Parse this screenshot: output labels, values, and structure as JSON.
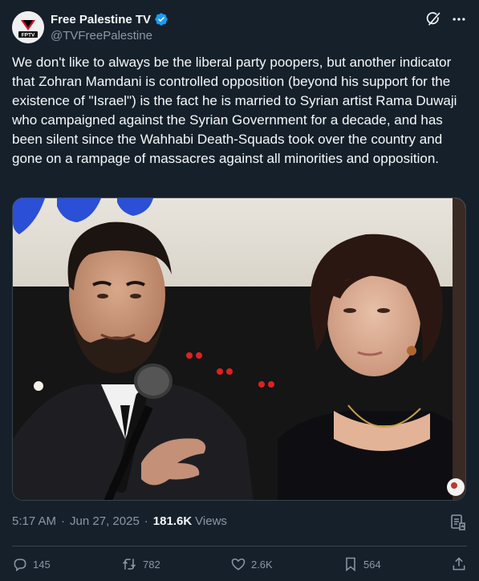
{
  "author": {
    "name": "Free Palestine TV",
    "handle": "@TVFreePalestine",
    "avatar_text": "FPTV",
    "verified": true
  },
  "header_icons": [
    "grok-icon",
    "more-icon"
  ],
  "tweet": {
    "text": "We don't like to always be the liberal party poopers, but another indicator that Zohran Mamdani is controlled opposition (beyond his support for the existence of \"Israel\") is the fact he is married to Syrian artist Rama Duwaji who campaigned against the Syrian Government for a decade, and has been silent since the Wahhabi Death-Squads took over the country and gone on a rampage of massacres against all minorities and opposition."
  },
  "meta": {
    "time": "5:17 AM",
    "date": "Jun 27, 2025",
    "separator": "·",
    "views_count": "181.6K",
    "views_label": "Views"
  },
  "actions": {
    "replies": "145",
    "reposts": "782",
    "likes": "2.6K",
    "bookmarks": "564"
  },
  "colors": {
    "background": "#15202b",
    "text": "#f7f9f9",
    "secondary": "#8b98a5",
    "border": "#38444d",
    "verified": "#1d9bf0"
  }
}
